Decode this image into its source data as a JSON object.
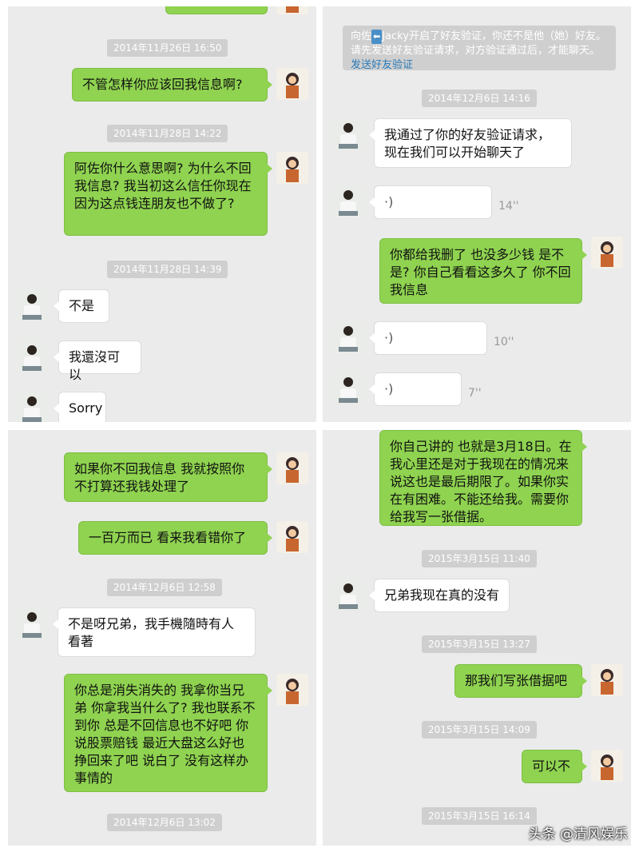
{
  "panel_tl": {
    "timestamps": [
      "2014年11月26日 16:50",
      "2014年11月28日 14:22",
      "2014年11月28日 14:39"
    ],
    "msg1": "不管怎样你应该回我信息啊?",
    "msg2": "阿佐你什么意思啊? 为什么不回我信息? 我当初这么信任你现在因为这点钱连朋友也不做了?",
    "msg3": "不是",
    "msg4": "我還沒可以",
    "msg5": "Sorry"
  },
  "panel_tr": {
    "system_pre": "向佐",
    "system_name": "Jacky",
    "system_post": "开启了好友验证，你还不是他（她）好友。请先发送好友验证请求，对方验证通过后，才能聊天。",
    "system_link": "发送好友验证",
    "timestamps": [
      "2014年12月6日 14:16"
    ],
    "msg1": "我通过了你的好友验证请求，现在我们可以开始聊天了",
    "voice1_dur": "14''",
    "msg2": "你都给我删了 也没多少钱 是不是? 你自己看看这多久了 你不回我信息",
    "voice2_dur": "10''",
    "voice3_dur": "7''"
  },
  "panel_bl": {
    "timestamps": [
      "2014年12月6日 12:58",
      "2014年12月6日 13:02"
    ],
    "msg1": "如果你不回我信息 我就按照你不打算还我钱处理了",
    "msg2": "一百万而已 看来我看错你了",
    "msg3": "不是呀兄弟，我手機隨時有人看著",
    "msg4": "你总是消失消失的 我拿你当兄弟 你拿我当什么了? 我也联系不到你 总是不回信息也不好吧 你说股票赔钱 最近大盘这么好也挣回来了吧 说白了 没有这样办事情的"
  },
  "panel_br": {
    "msg1": "你自己讲的 也就是3月18日。在我心里还是对于我现在的情况来说这也是最后期限了。如果你实在有困难。不能还给我。需要你给我写一张借据。",
    "timestamps": [
      "2015年3月15日 11:40",
      "2015年3月15日 13:27",
      "2015年3月15日 14:09",
      "2015年3月15日 16:14"
    ],
    "msg2": "兄弟我现在真的没有",
    "msg3": "那我们写张借据吧",
    "msg4": "可以不"
  },
  "watermark": "头条 @清风娱乐"
}
